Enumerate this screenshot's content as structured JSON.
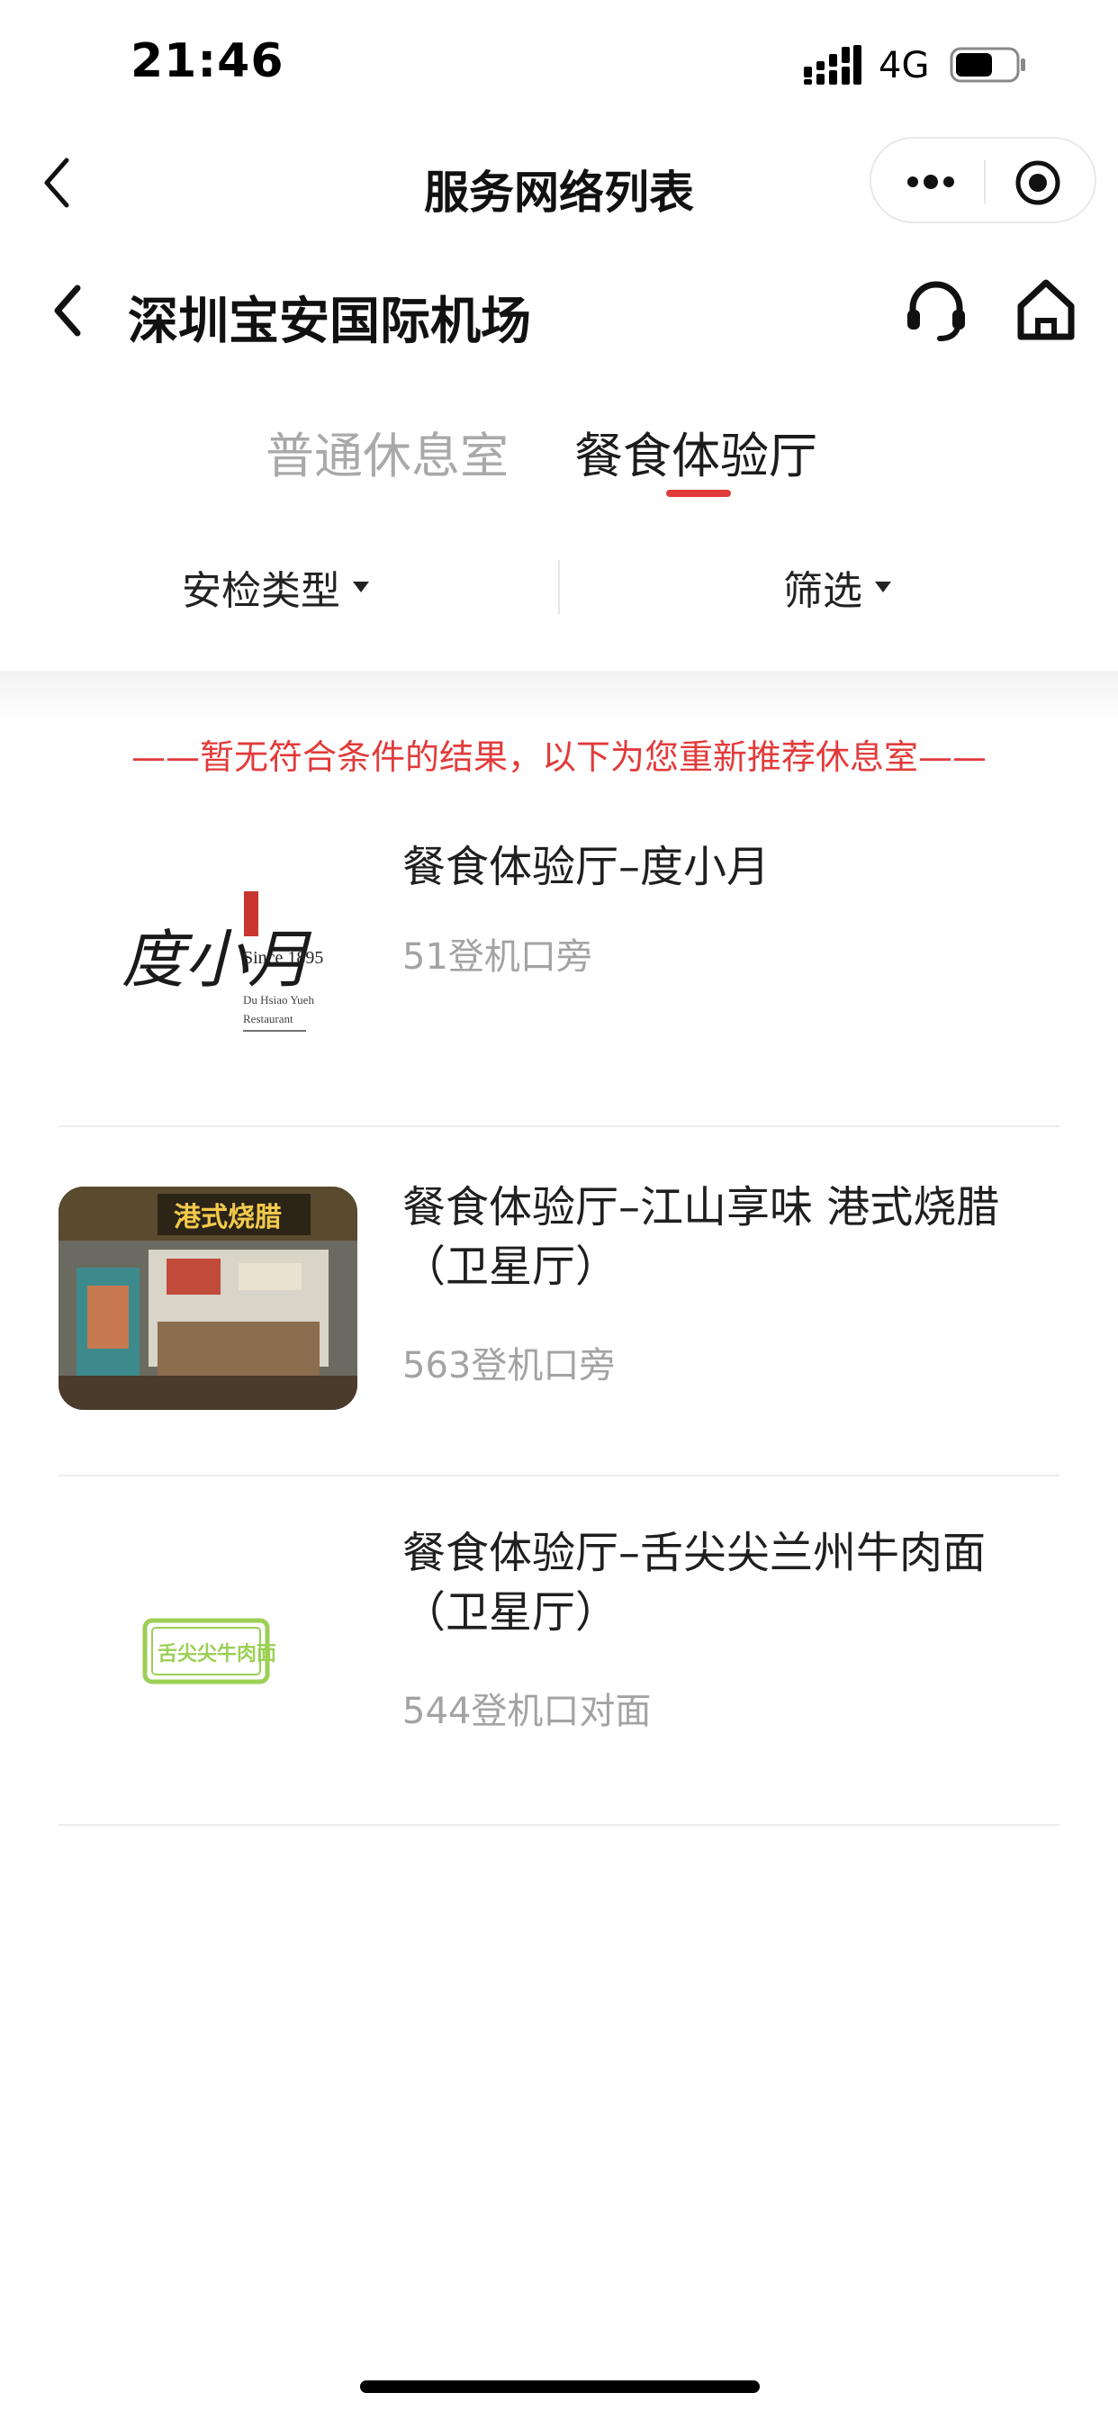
{
  "status_bar": {
    "time": "21:46",
    "network": "4G"
  },
  "nav": {
    "title": "服务网络列表"
  },
  "header": {
    "title": "深圳宝安国际机场"
  },
  "tabs": [
    {
      "label": "普通休息室",
      "active": false
    },
    {
      "label": "餐食体验厅",
      "active": true
    }
  ],
  "filters": {
    "security_type": "安检类型",
    "screen": "筛选"
  },
  "notice": "——暂无符合条件的结果，以下为您重新推荐休息室——",
  "items": [
    {
      "title": "餐食体验厅–度小月",
      "location": "51登机口旁",
      "logo_text": "度小月",
      "logo_since": "Since 1895",
      "logo_en1": "Du Hsiao Yueh",
      "logo_en2": "Restaurant"
    },
    {
      "title": "餐食体验厅–江山享味 港式烧腊（卫星厅）",
      "location": "563登机口旁",
      "photo_sign": "港式烧腊"
    },
    {
      "title": "餐食体验厅–舌尖尖兰州牛肉面（卫星厅）",
      "location": "544登机口对面",
      "logo_text": "舌尖尖牛肉面"
    }
  ],
  "colors": {
    "accent": "#e23b3b",
    "muted": "#a3a3a3",
    "logo_green": "#9ccf55"
  }
}
